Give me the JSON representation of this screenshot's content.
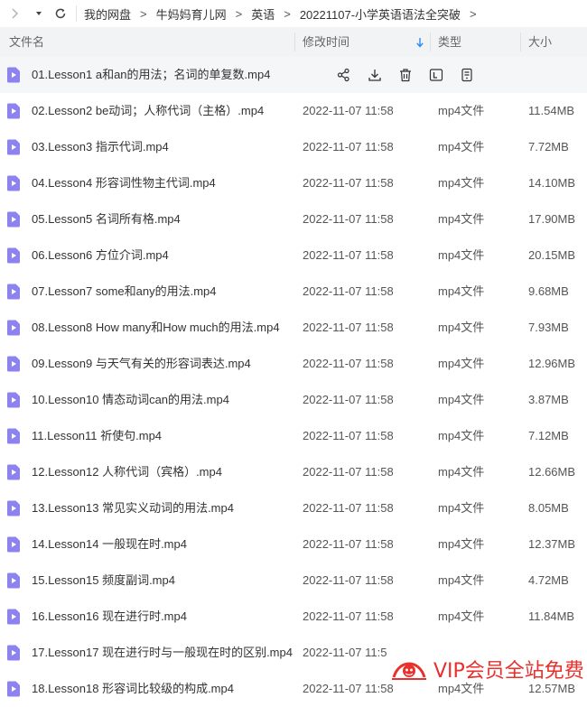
{
  "breadcrumb": {
    "items": [
      "我的网盘",
      "牛妈妈育儿网",
      "英语",
      "20221107-小学英语语法全突破"
    ],
    "separator": ">"
  },
  "columns": {
    "name": "文件名",
    "time": "修改时间",
    "type": "类型",
    "size": "大小"
  },
  "files": [
    {
      "name": "01.Lesson1 a和an的用法；名词的单复数.mp4",
      "time": "",
      "type": "",
      "size": ""
    },
    {
      "name": "02.Lesson2 be动词；人称代词（主格）.mp4",
      "time": "2022-11-07 11:58",
      "type": "mp4文件",
      "size": "11.54MB"
    },
    {
      "name": "03.Lesson3 指示代词.mp4",
      "time": "2022-11-07 11:58",
      "type": "mp4文件",
      "size": "7.72MB"
    },
    {
      "name": "04.Lesson4 形容词性物主代词.mp4",
      "time": "2022-11-07 11:58",
      "type": "mp4文件",
      "size": "14.10MB"
    },
    {
      "name": "05.Lesson5 名词所有格.mp4",
      "time": "2022-11-07 11:58",
      "type": "mp4文件",
      "size": "17.90MB"
    },
    {
      "name": "06.Lesson6 方位介词.mp4",
      "time": "2022-11-07 11:58",
      "type": "mp4文件",
      "size": "20.15MB"
    },
    {
      "name": "07.Lesson7 some和any的用法.mp4",
      "time": "2022-11-07 11:58",
      "type": "mp4文件",
      "size": "9.68MB"
    },
    {
      "name": "08.Lesson8 How many和How much的用法.mp4",
      "time": "2022-11-07 11:58",
      "type": "mp4文件",
      "size": "7.93MB"
    },
    {
      "name": "09.Lesson9 与天气有关的形容词表达.mp4",
      "time": "2022-11-07 11:58",
      "type": "mp4文件",
      "size": "12.96MB"
    },
    {
      "name": "10.Lesson10 情态动词can的用法.mp4",
      "time": "2022-11-07 11:58",
      "type": "mp4文件",
      "size": "3.87MB"
    },
    {
      "name": "11.Lesson11 祈使句.mp4",
      "time": "2022-11-07 11:58",
      "type": "mp4文件",
      "size": "7.12MB"
    },
    {
      "name": "12.Lesson12 人称代词（宾格）.mp4",
      "time": "2022-11-07 11:58",
      "type": "mp4文件",
      "size": "12.66MB"
    },
    {
      "name": "13.Lesson13 常见实义动词的用法.mp4",
      "time": "2022-11-07 11:58",
      "type": "mp4文件",
      "size": "8.05MB"
    },
    {
      "name": "14.Lesson14 一般现在时.mp4",
      "time": "2022-11-07 11:58",
      "type": "mp4文件",
      "size": "12.37MB"
    },
    {
      "name": "15.Lesson15 频度副词.mp4",
      "time": "2022-11-07 11:58",
      "type": "mp4文件",
      "size": "4.72MB"
    },
    {
      "name": "16.Lesson16 现在进行时.mp4",
      "time": "2022-11-07 11:58",
      "type": "mp4文件",
      "size": "11.84MB"
    },
    {
      "name": "17.Lesson17 现在进行时与一般现在时的区别.mp4",
      "time": "2022-11-07 11:5",
      "type": "",
      "size": ""
    },
    {
      "name": "18.Lesson18 形容词比较级的构成.mp4",
      "time": "2022-11-07 11:58",
      "type": "mp4文件",
      "size": "12.57MB"
    }
  ],
  "watermark": {
    "text": "VIP会员全站免费"
  },
  "colors": {
    "file_icon": "#8c83f0",
    "header_bg": "#f2f3f5",
    "sort_arrow": "#2a8cf0",
    "watermark": "#e8302c"
  }
}
